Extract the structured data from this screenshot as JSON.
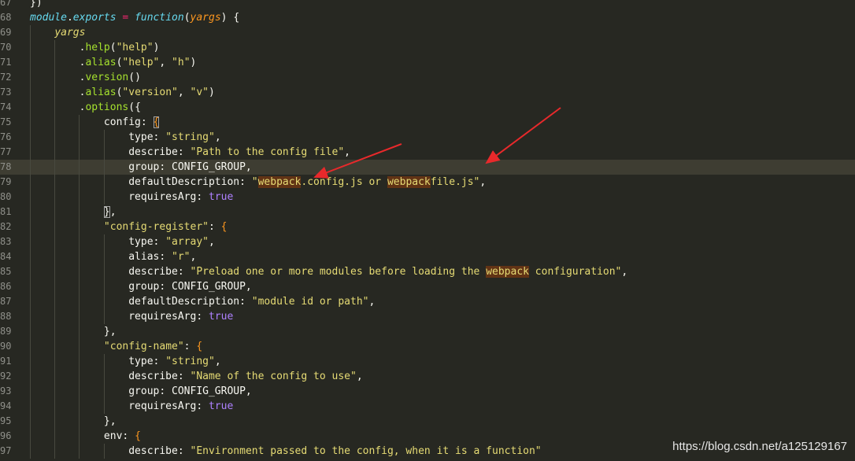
{
  "editor": {
    "lines": [
      {
        "n": "67",
        "hl": false,
        "guides": 0,
        "tokens": [
          {
            "t": "})",
            "c": "br"
          }
        ]
      },
      {
        "n": "68",
        "hl": false,
        "guides": 0,
        "tokens": [
          {
            "t": "module",
            "c": "kw"
          },
          {
            "t": ".",
            "c": "br"
          },
          {
            "t": "exports",
            "c": "kw"
          },
          {
            "t": " = ",
            "c": "op"
          },
          {
            "t": "function",
            "c": "kw"
          },
          {
            "t": "(",
            "c": "br"
          },
          {
            "t": "yargs",
            "c": "arg"
          },
          {
            "t": ") {",
            "c": "br"
          }
        ]
      },
      {
        "n": "69",
        "hl": false,
        "guides": 1,
        "tokens": [
          {
            "t": "    ",
            "c": "br"
          },
          {
            "t": "yargs",
            "c": "yg"
          }
        ]
      },
      {
        "n": "70",
        "hl": false,
        "guides": 2,
        "tokens": [
          {
            "t": "        .",
            "c": "br"
          },
          {
            "t": "help",
            "c": "fn"
          },
          {
            "t": "(",
            "c": "br"
          },
          {
            "t": "\"help\"",
            "c": "str"
          },
          {
            "t": ")",
            "c": "br"
          }
        ]
      },
      {
        "n": "71",
        "hl": false,
        "guides": 2,
        "tokens": [
          {
            "t": "        .",
            "c": "br"
          },
          {
            "t": "alias",
            "c": "fn"
          },
          {
            "t": "(",
            "c": "br"
          },
          {
            "t": "\"help\"",
            "c": "str"
          },
          {
            "t": ", ",
            "c": "br"
          },
          {
            "t": "\"h\"",
            "c": "str"
          },
          {
            "t": ")",
            "c": "br"
          }
        ]
      },
      {
        "n": "72",
        "hl": false,
        "guides": 2,
        "tokens": [
          {
            "t": "        .",
            "c": "br"
          },
          {
            "t": "version",
            "c": "fn"
          },
          {
            "t": "()",
            "c": "br"
          }
        ]
      },
      {
        "n": "73",
        "hl": false,
        "guides": 2,
        "tokens": [
          {
            "t": "        .",
            "c": "br"
          },
          {
            "t": "alias",
            "c": "fn"
          },
          {
            "t": "(",
            "c": "br"
          },
          {
            "t": "\"version\"",
            "c": "str"
          },
          {
            "t": ", ",
            "c": "br"
          },
          {
            "t": "\"v\"",
            "c": "str"
          },
          {
            "t": ")",
            "c": "br"
          }
        ]
      },
      {
        "n": "74",
        "hl": false,
        "guides": 2,
        "tokens": [
          {
            "t": "        .",
            "c": "br"
          },
          {
            "t": "options",
            "c": "fn"
          },
          {
            "t": "({",
            "c": "br"
          }
        ]
      },
      {
        "n": "75",
        "hl": false,
        "guides": 3,
        "tokens": [
          {
            "t": "            config: ",
            "c": "br"
          },
          {
            "t": "{",
            "c": "bro bm"
          }
        ]
      },
      {
        "n": "76",
        "hl": false,
        "guides": 4,
        "tokens": [
          {
            "t": "                type: ",
            "c": "br"
          },
          {
            "t": "\"string\"",
            "c": "str"
          },
          {
            "t": ",",
            "c": "br"
          }
        ]
      },
      {
        "n": "77",
        "hl": false,
        "guides": 4,
        "tokens": [
          {
            "t": "                describe: ",
            "c": "br"
          },
          {
            "t": "\"Path to the config file\"",
            "c": "str"
          },
          {
            "t": ",",
            "c": "br"
          }
        ]
      },
      {
        "n": "78",
        "hl": true,
        "guides": 4,
        "tokens": [
          {
            "t": "                group: CONFIG_GROUP,",
            "c": "br"
          }
        ]
      },
      {
        "n": "79",
        "hl": false,
        "guides": 4,
        "tokens": [
          {
            "t": "                defaultDescription: ",
            "c": "br"
          },
          {
            "t": "\"",
            "c": "str"
          },
          {
            "t": "webpack",
            "c": "str mh"
          },
          {
            "t": ".config.js or ",
            "c": "str"
          },
          {
            "t": "webpack",
            "c": "str mh"
          },
          {
            "t": "file.js\"",
            "c": "str"
          },
          {
            "t": ",",
            "c": "br"
          }
        ]
      },
      {
        "n": "80",
        "hl": false,
        "guides": 4,
        "tokens": [
          {
            "t": "                requiresArg: ",
            "c": "br"
          },
          {
            "t": "true",
            "c": "bool"
          }
        ]
      },
      {
        "n": "81",
        "hl": false,
        "guides": 3,
        "tokens": [
          {
            "t": "            ",
            "c": "br"
          },
          {
            "t": "}",
            "c": "br bm"
          },
          {
            "t": ",",
            "c": "br"
          }
        ]
      },
      {
        "n": "82",
        "hl": false,
        "guides": 3,
        "tokens": [
          {
            "t": "            ",
            "c": "br"
          },
          {
            "t": "\"config-register\"",
            "c": "str"
          },
          {
            "t": ": ",
            "c": "br"
          },
          {
            "t": "{",
            "c": "bro"
          }
        ]
      },
      {
        "n": "83",
        "hl": false,
        "guides": 4,
        "tokens": [
          {
            "t": "                type: ",
            "c": "br"
          },
          {
            "t": "\"array\"",
            "c": "str"
          },
          {
            "t": ",",
            "c": "br"
          }
        ]
      },
      {
        "n": "84",
        "hl": false,
        "guides": 4,
        "tokens": [
          {
            "t": "                alias: ",
            "c": "br"
          },
          {
            "t": "\"r\"",
            "c": "str"
          },
          {
            "t": ",",
            "c": "br"
          }
        ]
      },
      {
        "n": "85",
        "hl": false,
        "guides": 4,
        "tokens": [
          {
            "t": "                describe: ",
            "c": "br"
          },
          {
            "t": "\"Preload one or more modules before loading the ",
            "c": "str"
          },
          {
            "t": "webpack",
            "c": "str mh"
          },
          {
            "t": " configuration\"",
            "c": "str"
          },
          {
            "t": ",",
            "c": "br"
          }
        ]
      },
      {
        "n": "86",
        "hl": false,
        "guides": 4,
        "tokens": [
          {
            "t": "                group: CONFIG_GROUP,",
            "c": "br"
          }
        ]
      },
      {
        "n": "87",
        "hl": false,
        "guides": 4,
        "tokens": [
          {
            "t": "                defaultDescription: ",
            "c": "br"
          },
          {
            "t": "\"module id or path\"",
            "c": "str"
          },
          {
            "t": ",",
            "c": "br"
          }
        ]
      },
      {
        "n": "88",
        "hl": false,
        "guides": 4,
        "tokens": [
          {
            "t": "                requiresArg: ",
            "c": "br"
          },
          {
            "t": "true",
            "c": "bool"
          }
        ]
      },
      {
        "n": "89",
        "hl": false,
        "guides": 3,
        "tokens": [
          {
            "t": "            },",
            "c": "br"
          }
        ]
      },
      {
        "n": "90",
        "hl": false,
        "guides": 3,
        "tokens": [
          {
            "t": "            ",
            "c": "br"
          },
          {
            "t": "\"config-name\"",
            "c": "str"
          },
          {
            "t": ": ",
            "c": "br"
          },
          {
            "t": "{",
            "c": "bro"
          }
        ]
      },
      {
        "n": "91",
        "hl": false,
        "guides": 4,
        "tokens": [
          {
            "t": "                type: ",
            "c": "br"
          },
          {
            "t": "\"string\"",
            "c": "str"
          },
          {
            "t": ",",
            "c": "br"
          }
        ]
      },
      {
        "n": "92",
        "hl": false,
        "guides": 4,
        "tokens": [
          {
            "t": "                describe: ",
            "c": "br"
          },
          {
            "t": "\"Name of the config to use\"",
            "c": "str"
          },
          {
            "t": ",",
            "c": "br"
          }
        ]
      },
      {
        "n": "93",
        "hl": false,
        "guides": 4,
        "tokens": [
          {
            "t": "                group: CONFIG_GROUP,",
            "c": "br"
          }
        ]
      },
      {
        "n": "94",
        "hl": false,
        "guides": 4,
        "tokens": [
          {
            "t": "                requiresArg: ",
            "c": "br"
          },
          {
            "t": "true",
            "c": "bool"
          }
        ]
      },
      {
        "n": "95",
        "hl": false,
        "guides": 3,
        "tokens": [
          {
            "t": "            },",
            "c": "br"
          }
        ]
      },
      {
        "n": "96",
        "hl": false,
        "guides": 3,
        "tokens": [
          {
            "t": "            env: ",
            "c": "br"
          },
          {
            "t": "{",
            "c": "bro"
          }
        ]
      },
      {
        "n": "97",
        "hl": false,
        "guides": 4,
        "tokens": [
          {
            "t": "                describe: ",
            "c": "br"
          },
          {
            "t": "\"Environment passed to the config, when it is a function\"",
            "c": "str"
          }
        ]
      }
    ]
  },
  "annotation": {
    "arrow_color": "#e8292b"
  },
  "watermark": "https://blog.csdn.net/a125129167"
}
